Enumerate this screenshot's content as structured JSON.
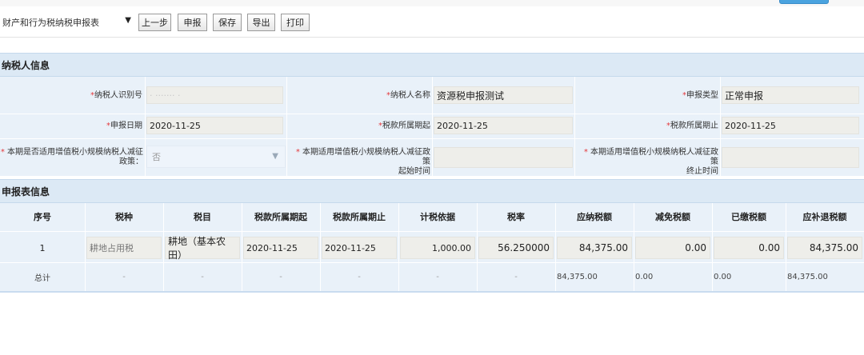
{
  "toolbar": {
    "select_value": "财产和行为税纳税申报表",
    "buttons": [
      "上一步",
      "申报",
      "保存",
      "导出",
      "打印"
    ]
  },
  "taxpayer_section": {
    "title": "纳税人信息",
    "taxpayer_id_label": "纳税人识别号",
    "taxpayer_id_value": "·  ······· ·",
    "taxpayer_name_label": "纳税人名称",
    "taxpayer_name_value": "资源税申报测试",
    "declare_type_label": "申报类型",
    "declare_type_value": "正常申报",
    "declare_date_label": "申报日期",
    "declare_date_value": "2020-11-25",
    "period_start_label": "税款所属期起",
    "period_start_value": "2020-11-25",
    "period_end_label": "税款所属期止",
    "period_end_value": "2020-11-25",
    "small_scale_label_1": "本期是否适用增值税小规模纳税人减征",
    "small_scale_label_2": "政策：",
    "small_scale_value": "否",
    "policy_start_label_1": "本期适用增值税小规模纳税人减征政策",
    "policy_start_label_2": "起始时间",
    "policy_end_label_1": "本期适用增值税小规模纳税人减征政策",
    "policy_end_label_2": "终止时间"
  },
  "declaration_section": {
    "title": "申报表信息",
    "headers": [
      "序号",
      "税种",
      "税目",
      "税款所属期起",
      "税款所属期止",
      "计税依据",
      "税率",
      "应纳税额",
      "减免税额",
      "已缴税额",
      "应补退税额"
    ],
    "row": {
      "no": "1",
      "tax_type": "耕地占用税",
      "tax_item": "耕地（基本农田）",
      "period_start": "2020-11-25",
      "period_end": "2020-11-25",
      "basis": "1,000.00",
      "rate": "56.250000",
      "payable": "84,375.00",
      "relief": "0.00",
      "paid": "0.00",
      "refund": "84,375.00"
    },
    "total": {
      "label": "总计",
      "tax_type": "-",
      "tax_item": "-",
      "period_start": "-",
      "period_end": "-",
      "basis": "-",
      "rate": "-",
      "payable": "84,375.00",
      "relief": "0.00",
      "paid": "0.00",
      "refund": "84,375.00"
    }
  },
  "colors": {
    "section_header_bg": "#dce9f5",
    "grid_bg": "#e9f1f9",
    "field_bg": "#eeeeea",
    "required": "#e4393c"
  }
}
